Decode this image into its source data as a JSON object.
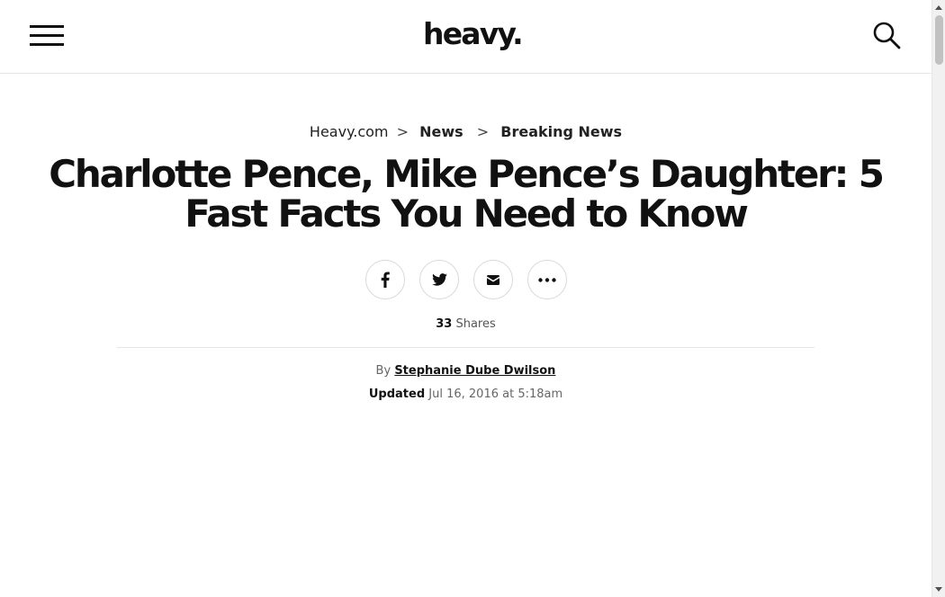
{
  "header": {
    "logo_text": "heavy."
  },
  "breadcrumb": {
    "home": "Heavy.com",
    "sep": ">",
    "section": "News",
    "subsection": "Breaking News"
  },
  "article": {
    "title": "Charlotte Pence, Mike Pence’s Daughter: 5 Fast Facts You Need to Know",
    "share_count": "33",
    "share_label": "Shares",
    "by_label": "By",
    "author": "Stephanie Dube Dwilson",
    "updated_label": "Updated",
    "updated_date": "Jul 16, 2016 at 5:18am"
  },
  "share_buttons": [
    {
      "icon": "facebook-icon"
    },
    {
      "icon": "twitter-icon"
    },
    {
      "icon": "email-icon"
    },
    {
      "icon": "more-icon"
    }
  ]
}
